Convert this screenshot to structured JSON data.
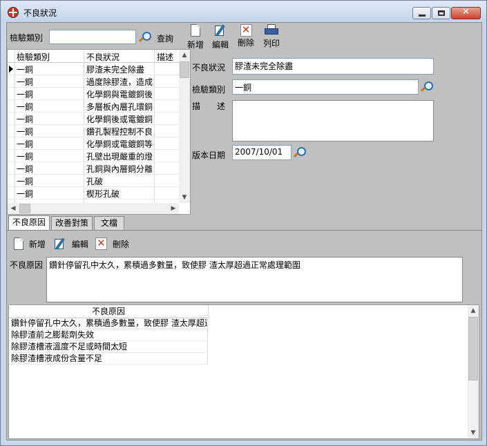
{
  "window": {
    "title": "不良狀況"
  },
  "search": {
    "label": "檢驗類別",
    "value": "",
    "query_label": "查詢"
  },
  "toolbar": {
    "new_label": "新增",
    "edit_label": "編輯",
    "delete_label": "刪除",
    "print_label": "列印"
  },
  "list": {
    "columns": [
      "檢驗類別",
      "不良狀況",
      "描述"
    ],
    "rows": [
      {
        "category": "一銅",
        "status": "膠渣未完全除盡"
      },
      {
        "category": "一銅",
        "status": "過度除膠渣，造成"
      },
      {
        "category": "一銅",
        "status": "化學銅與電鍍銅後"
      },
      {
        "category": "一銅",
        "status": "多層板內層孔環銅"
      },
      {
        "category": "一銅",
        "status": "化學銅後或電鍍銅"
      },
      {
        "category": "一銅",
        "status": "鑽孔製程控制不良"
      },
      {
        "category": "一銅",
        "status": "化學銅或電鍍銅等"
      },
      {
        "category": "一銅",
        "status": "孔壁出現嚴重的燈"
      },
      {
        "category": "一銅",
        "status": "孔銅與內層銅分離"
      },
      {
        "category": "一銅",
        "status": "孔破"
      },
      {
        "category": "一銅",
        "status": "楔形孔破"
      }
    ]
  },
  "detail": {
    "status_label": "不良狀況",
    "status_value": "膠渣未完全除盡",
    "category_label": "檢驗類別",
    "category_value": "一銅",
    "desc_label": "描　　述",
    "desc_value": "",
    "date_label": "版本日期",
    "date_value": "2007/10/01"
  },
  "tabs": [
    "不良原因",
    "改善對策",
    "文檔"
  ],
  "subtoolbar": {
    "new_label": "新增",
    "edit_label": "編輯",
    "delete_label": "刪除"
  },
  "cause": {
    "label": "不良原因",
    "value": "鑽針停留孔中太久，累積過多數量，致使膠 渣太厚超過正常處理範圍"
  },
  "cause_list": {
    "header": "不良原因",
    "rows": [
      "鑽針停留孔中太久，累積過多數量，致使膠 渣太厚超過",
      "除膠渣前之膨鬆劑失效",
      "除膠渣槽液溫度不足或時間太短",
      "除膠渣槽液成份含量不足"
    ]
  }
}
